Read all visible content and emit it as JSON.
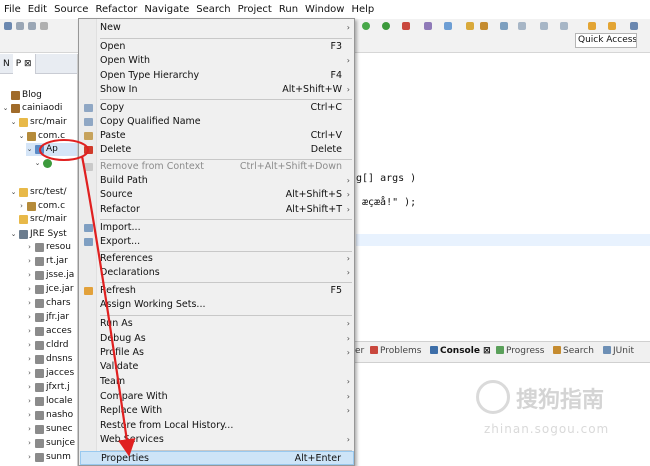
{
  "menubar": [
    "File",
    "Edit",
    "Source",
    "Refactor",
    "Navigate",
    "Search",
    "Project",
    "Run",
    "Window",
    "Help"
  ],
  "toolbar": {
    "quick_access": "Quick Access"
  },
  "explorer": {
    "tabs": [
      "N",
      "P"
    ],
    "tab_close": "⊠",
    "rows": [
      {
        "text": "Blog"
      },
      {
        "text": "cainiaodi"
      },
      {
        "text": "src/mair"
      },
      {
        "text": "com.c"
      },
      {
        "text": "Ap"
      },
      {
        "text": ""
      },
      {
        "text": "src/test/"
      },
      {
        "text": "com.c"
      },
      {
        "text": "src/mair"
      },
      {
        "text": "JRE Syst"
      },
      {
        "text": "resou"
      },
      {
        "text": "rt.jar"
      },
      {
        "text": "jsse.ja"
      },
      {
        "text": "jce.jar"
      },
      {
        "text": "chars"
      },
      {
        "text": "jfr.jar"
      },
      {
        "text": "acces"
      },
      {
        "text": "cldrd"
      },
      {
        "text": "dnsns"
      },
      {
        "text": "jacces"
      },
      {
        "text": "jfxrt.j"
      },
      {
        "text": "locale"
      },
      {
        "text": "nasho"
      },
      {
        "text": "sunec"
      },
      {
        "text": "sunjce"
      },
      {
        "text": "sunm"
      }
    ]
  },
  "editor": {
    "line1": "g[] args )",
    "line2": "æçæå!\" );"
  },
  "bottom_tabs": {
    "partial": "er",
    "problems": "Problems",
    "console": "Console",
    "console_close": "⊠",
    "progress": "Progress",
    "search": "Search",
    "junit": "JUnit"
  },
  "context_menu": {
    "submenu_arrow": "›",
    "items": [
      {
        "label": "New",
        "shortcut": ""
      },
      {
        "label": "Open",
        "shortcut": "F3"
      },
      {
        "label": "Open With",
        "shortcut": ""
      },
      {
        "label": "Open Type Hierarchy",
        "shortcut": "F4"
      },
      {
        "label": "Show In",
        "shortcut": "Alt+Shift+W"
      },
      {
        "label": "Copy",
        "shortcut": "Ctrl+C"
      },
      {
        "label": "Copy Qualified Name",
        "shortcut": ""
      },
      {
        "label": "Paste",
        "shortcut": "Ctrl+V"
      },
      {
        "label": "Delete",
        "shortcut": "Delete"
      },
      {
        "label": "Remove from Context",
        "shortcut": "Ctrl+Alt+Shift+Down"
      },
      {
        "label": "Build Path",
        "shortcut": ""
      },
      {
        "label": "Source",
        "shortcut": "Alt+Shift+S"
      },
      {
        "label": "Refactor",
        "shortcut": "Alt+Shift+T"
      },
      {
        "label": "Import...",
        "shortcut": ""
      },
      {
        "label": "Export...",
        "shortcut": ""
      },
      {
        "label": "References",
        "shortcut": ""
      },
      {
        "label": "Declarations",
        "shortcut": ""
      },
      {
        "label": "Refresh",
        "shortcut": "F5"
      },
      {
        "label": "Assign Working Sets...",
        "shortcut": ""
      },
      {
        "label": "Run As",
        "shortcut": ""
      },
      {
        "label": "Debug As",
        "shortcut": ""
      },
      {
        "label": "Profile As",
        "shortcut": ""
      },
      {
        "label": "Validate",
        "shortcut": ""
      },
      {
        "label": "Team",
        "shortcut": ""
      },
      {
        "label": "Compare With",
        "shortcut": ""
      },
      {
        "label": "Replace With",
        "shortcut": ""
      },
      {
        "label": "Restore from Local History...",
        "shortcut": ""
      },
      {
        "label": "Web Services",
        "shortcut": ""
      },
      {
        "label": "Properties",
        "shortcut": "Alt+Enter"
      }
    ]
  },
  "watermark": {
    "text": "搜狗指南",
    "url": "zhinan.sogou.com"
  },
  "colors": {
    "highlight": "#cde4f7",
    "annotation_red": "#e02020"
  }
}
